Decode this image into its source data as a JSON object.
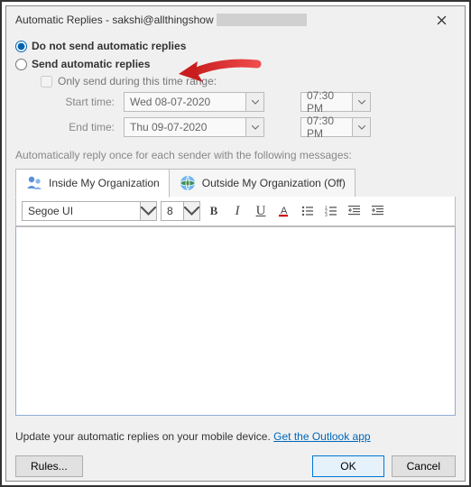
{
  "window": {
    "title": "Automatic Replies - sakshi@allthingshow"
  },
  "options": {
    "dont_send": "Do not send automatic replies",
    "send": "Send automatic replies",
    "only_range": "Only send during this time range:",
    "start_label": "Start time:",
    "end_label": "End time:",
    "start_date": "Wed 08-07-2020",
    "start_time": "07:30 PM",
    "end_date": "Thu 09-07-2020",
    "end_time": "07:30 PM"
  },
  "hint": "Automatically reply once for each sender with the following messages:",
  "tabs": {
    "inside": "Inside My Organization",
    "outside": "Outside My Organization (Off)"
  },
  "toolbar": {
    "font": "Segoe UI",
    "size": "8",
    "bold": "B",
    "italic": "I",
    "underline": "U",
    "fontcolor": "A"
  },
  "footer": {
    "text": "Update your automatic replies on your mobile device. ",
    "link": "Get the Outlook app"
  },
  "buttons": {
    "rules": "Rules...",
    "ok": "OK",
    "cancel": "Cancel"
  }
}
